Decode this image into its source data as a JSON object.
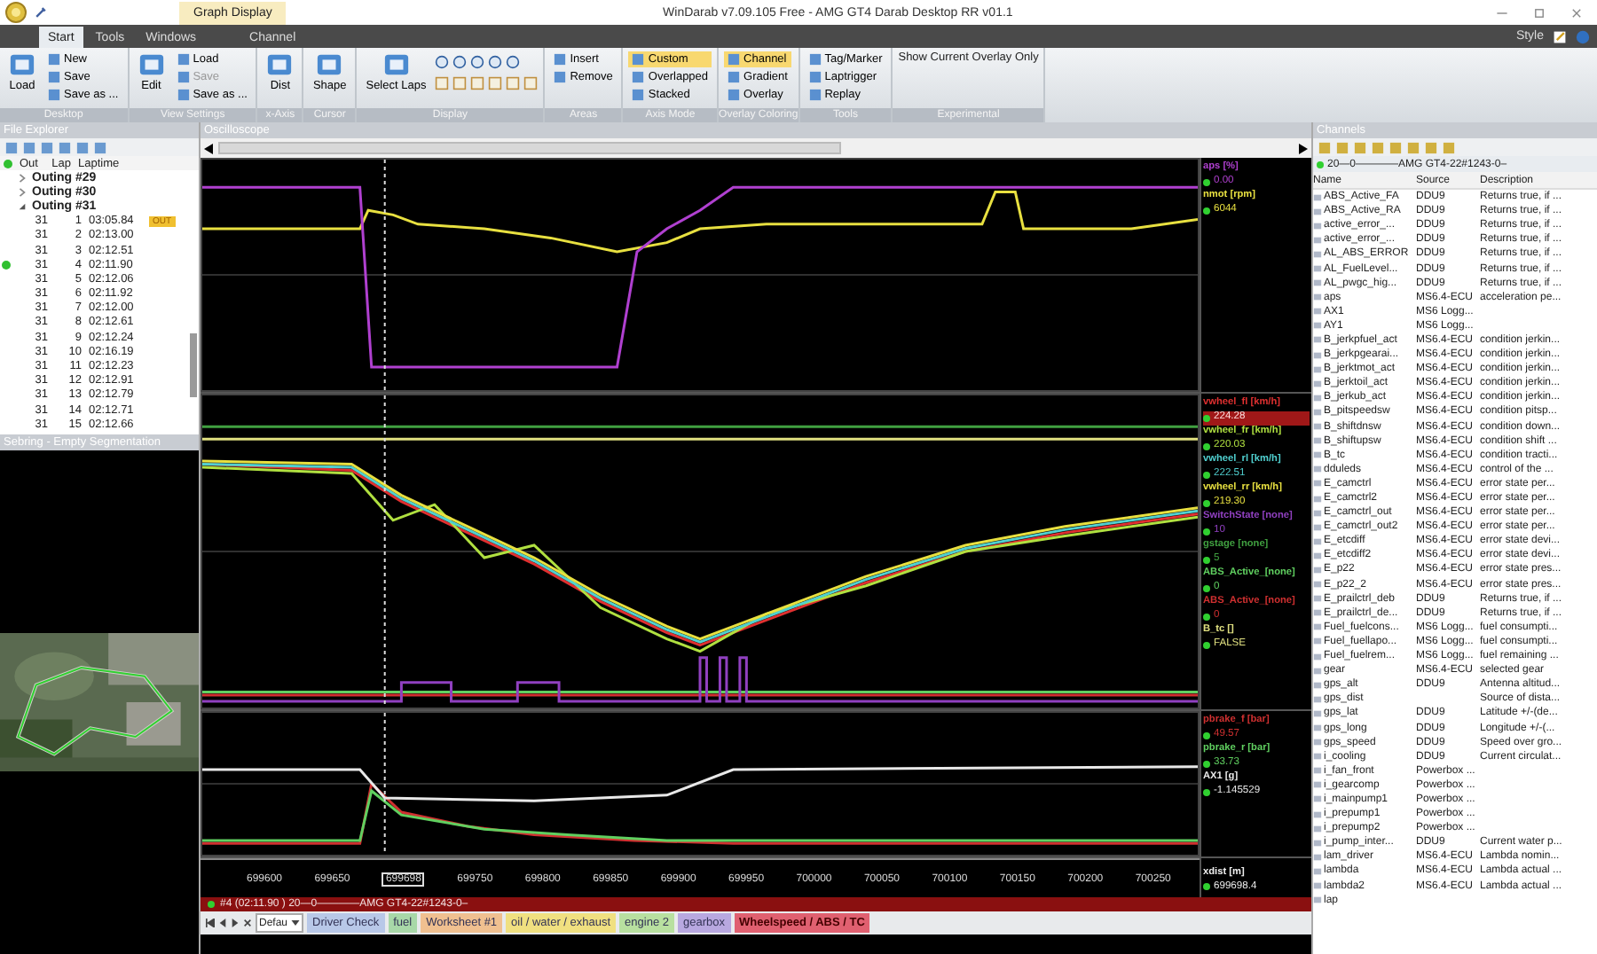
{
  "window": {
    "quick_tab": "Graph Display",
    "title": "WinDarab v7.09.105 Free - AMG GT4 Darab Desktop RR v01.1"
  },
  "menu_tabs": [
    {
      "label": "Start",
      "selected": true
    },
    {
      "label": "Tools",
      "selected": false
    },
    {
      "label": "Windows",
      "selected": false
    },
    {
      "label": "Channel",
      "selected": false
    }
  ],
  "style_label": "Style",
  "ribbon": [
    {
      "label": "Desktop",
      "kind": "standard",
      "items": [
        {
          "label": "Load",
          "kind": "large"
        },
        {
          "label": "New",
          "kind": "small"
        },
        {
          "label": "Save",
          "kind": "small"
        },
        {
          "label": "Save as ...",
          "kind": "small"
        }
      ]
    },
    {
      "label": "View Settings",
      "kind": "standard",
      "items": [
        {
          "label": "Edit",
          "kind": "large",
          "disabled": false
        },
        {
          "label": "Load",
          "kind": "small",
          "disabled": false
        },
        {
          "label": "Save",
          "kind": "small",
          "disabled": true
        },
        {
          "label": "Save as ...",
          "kind": "small",
          "disabled": false
        }
      ]
    },
    {
      "label": "x-Axis",
      "kind": "standard",
      "items": [
        {
          "label": "Dist",
          "kind": "large"
        }
      ]
    },
    {
      "label": "Cursor",
      "kind": "standard",
      "items": [
        {
          "label": "Shape",
          "kind": "large"
        }
      ]
    },
    {
      "label": "Display",
      "kind": "icons",
      "items": [
        {
          "label": "Select Laps",
          "kind": "large"
        }
      ]
    },
    {
      "label": "Areas",
      "kind": "standard",
      "items": [
        {
          "label": "Insert",
          "kind": "small"
        },
        {
          "label": "Remove",
          "kind": "small"
        }
      ]
    },
    {
      "label": "Axis Mode",
      "kind": "standard",
      "items": [
        {
          "label": "Custom",
          "kind": "small",
          "selected": true
        },
        {
          "label": "Overlapped",
          "kind": "small",
          "selected": false
        },
        {
          "label": "Stacked",
          "kind": "small",
          "selected": false
        }
      ]
    },
    {
      "label": "Overlay Coloring",
      "kind": "standard",
      "items": [
        {
          "label": "Channel",
          "kind": "small",
          "selected": true
        },
        {
          "label": "Gradient",
          "kind": "small",
          "selected": false
        },
        {
          "label": "Overlay",
          "kind": "small",
          "selected": false
        }
      ]
    },
    {
      "label": "Tools",
      "kind": "standard",
      "items": [
        {
          "label": "Tag/Marker",
          "kind": "small"
        },
        {
          "label": "Laptrigger",
          "kind": "small"
        },
        {
          "label": "Replay",
          "kind": "small"
        }
      ]
    },
    {
      "label": "Experimental",
      "kind": "standard",
      "items": [
        {
          "label": "Show Current Overlay Only",
          "kind": "text"
        }
      ]
    }
  ],
  "file_explorer": {
    "title": "File Explorer",
    "columns": [
      "Out",
      "Lap",
      "Laptime"
    ],
    "outings": [
      {
        "label": "Outing #29",
        "expanded": false
      },
      {
        "label": "Outing #30",
        "expanded": false
      },
      {
        "label": "Outing #31",
        "expanded": true,
        "laps": [
          {
            "out": "31",
            "lap": "1",
            "time": "03:05.84",
            "badge": "OUT",
            "loaded": false
          },
          {
            "out": "31",
            "lap": "2",
            "time": "02:13.00",
            "loaded": false
          },
          {
            "out": "31",
            "lap": "3",
            "time": "02:12.51",
            "loaded": false
          },
          {
            "out": "31",
            "lap": "4",
            "time": "02:11.90",
            "loaded": true
          },
          {
            "out": "31",
            "lap": "5",
            "time": "02:12.06",
            "loaded": false
          },
          {
            "out": "31",
            "lap": "6",
            "time": "02:11.92",
            "loaded": false
          },
          {
            "out": "31",
            "lap": "7",
            "time": "02:12.00",
            "loaded": false
          },
          {
            "out": "31",
            "lap": "8",
            "time": "02:12.61",
            "loaded": false
          },
          {
            "out": "31",
            "lap": "9",
            "time": "02:12.24",
            "loaded": false
          },
          {
            "out": "31",
            "lap": "10",
            "time": "02:16.19",
            "loaded": false
          },
          {
            "out": "31",
            "lap": "11",
            "time": "02:12.23",
            "loaded": false
          },
          {
            "out": "31",
            "lap": "12",
            "time": "02:12.91",
            "loaded": false
          },
          {
            "out": "31",
            "lap": "13",
            "time": "02:12.79",
            "loaded": false
          },
          {
            "out": "31",
            "lap": "14",
            "time": "02:12.71",
            "loaded": false
          },
          {
            "out": "31",
            "lap": "15",
            "time": "02:12.66",
            "loaded": false
          }
        ]
      }
    ]
  },
  "track_panel": {
    "title": "Sebring - Empty Segmentation"
  },
  "oscilloscope": {
    "title": "Oscilloscope",
    "panes": [
      {
        "legend": [
          {
            "label": "aps [%]",
            "value": "0.00",
            "color": "#b040d0",
            "selected": false
          },
          {
            "label": "nmot [rpm]",
            "value": "6044",
            "color": "#e8e040",
            "selected": false
          }
        ]
      },
      {
        "legend": [
          {
            "label": "vwheel_fl [km/h]",
            "value": "224.28",
            "color": "#e03030",
            "selected": true
          },
          {
            "label": "vwheel_fr [km/h]",
            "value": "220.03",
            "color": "#b0e040",
            "selected": false
          },
          {
            "label": "vwheel_rl [km/h]",
            "value": "222.51",
            "color": "#50d0d0",
            "selected": false
          },
          {
            "label": "vwheel_rr [km/h]",
            "value": "219.30",
            "color": "#e8e040",
            "selected": false
          },
          {
            "label": "SwitchState [none]",
            "value": "10",
            "color": "#9040c0",
            "selected": false
          },
          {
            "label": "gstage [none]",
            "value": "5",
            "color": "#40a040",
            "selected": false
          },
          {
            "label": "ABS_Active_[none]",
            "value": "0",
            "color": "#60d060",
            "selected": false
          },
          {
            "label": "ABS_Active_[none]",
            "value": "0",
            "color": "#d03030",
            "selected": false
          },
          {
            "label": "B_tc []",
            "value": "FALSE",
            "color": "#e0e080",
            "selected": false
          }
        ]
      },
      {
        "legend": [
          {
            "label": "pbrake_f [bar]",
            "value": "49.57",
            "color": "#d03030",
            "selected": false
          },
          {
            "label": "pbrake_r [bar]",
            "value": "33.73",
            "color": "#60d060",
            "selected": false
          },
          {
            "label": "AX1 [g]",
            "value": "-1.145529",
            "color": "#e8e8e8",
            "selected": false
          }
        ]
      }
    ],
    "x_ticks": [
      {
        "label": "699600",
        "cursor": false
      },
      {
        "label": "699650",
        "cursor": false
      },
      {
        "label": "699698",
        "cursor": true
      },
      {
        "label": "699750",
        "cursor": false
      },
      {
        "label": "699800",
        "cursor": false
      },
      {
        "label": "699850",
        "cursor": false
      },
      {
        "label": "699900",
        "cursor": false
      },
      {
        "label": "699950",
        "cursor": false
      },
      {
        "label": "700000",
        "cursor": false
      },
      {
        "label": "700050",
        "cursor": false
      },
      {
        "label": "700100",
        "cursor": false
      },
      {
        "label": "700150",
        "cursor": false
      },
      {
        "label": "700200",
        "cursor": false
      },
      {
        "label": "700250",
        "cursor": false
      }
    ],
    "x_legend": {
      "label": "xdist [m]",
      "value": "699698.4"
    },
    "status": "#4 (02:11.90 ) 20—0————AMG GT4-22#1243-0–"
  },
  "worksheet_tabs": {
    "layout": "Defau",
    "tabs": [
      {
        "label": "Driver Check",
        "color": "#b8c8e8",
        "selected": false
      },
      {
        "label": "fuel",
        "color": "#a8d8a8",
        "selected": false
      },
      {
        "label": "Worksheet #1",
        "color": "#f0c090",
        "selected": false
      },
      {
        "label": "oil / water / exhaust",
        "color": "#f0e080",
        "selected": false
      },
      {
        "label": "engine 2",
        "color": "#b8e0a0",
        "selected": false
      },
      {
        "label": "gearbox",
        "color": "#b8a8e0",
        "selected": false
      },
      {
        "label": "Wheelspeed / ABS / TC",
        "color": "#e06070",
        "selected": true
      }
    ]
  },
  "channels": {
    "title": "Channels",
    "dataset": "20—0————AMG GT4-22#1243-0–",
    "columns": [
      "Name",
      "Source",
      "Description"
    ],
    "rows": [
      {
        "name": "ABS_Active_FA",
        "source": "DDU9",
        "description": "Returns true, if ..."
      },
      {
        "name": "ABS_Active_RA",
        "source": "DDU9",
        "description": "Returns true, if ..."
      },
      {
        "name": "active_error_...",
        "source": "DDU9",
        "description": "Returns true, if ..."
      },
      {
        "name": "active_error_...",
        "source": "DDU9",
        "description": "Returns true, if ..."
      },
      {
        "name": "AL_ABS_ERROR",
        "source": "DDU9",
        "description": "Returns true, if ..."
      },
      {
        "name": "AL_FuelLevel...",
        "source": "DDU9",
        "description": "Returns true, if ..."
      },
      {
        "name": "AL_pwgc_hig...",
        "source": "DDU9",
        "description": "Returns true, if ..."
      },
      {
        "name": "aps",
        "source": "MS6.4-ECU",
        "description": "acceleration pe..."
      },
      {
        "name": "AX1",
        "source": "MS6 Logg..."
      },
      {
        "name": "AY1",
        "source": "MS6 Logg..."
      },
      {
        "name": "B_jerkpfuel_act",
        "source": "MS6.4-ECU",
        "description": "condition jerkin..."
      },
      {
        "name": "B_jerkpgearai...",
        "source": "MS6.4-ECU",
        "description": "condition jerkin..."
      },
      {
        "name": "B_jerktmot_act",
        "source": "MS6.4-ECU",
        "description": "condition jerkin..."
      },
      {
        "name": "B_jerktoil_act",
        "source": "MS6.4-ECU",
        "description": "condition jerkin..."
      },
      {
        "name": "B_jerkub_act",
        "source": "MS6.4-ECU",
        "description": "condition jerkin..."
      },
      {
        "name": "B_pitspeedsw",
        "source": "MS6.4-ECU",
        "description": "condition pitsp..."
      },
      {
        "name": "B_shiftdnsw",
        "source": "MS6.4-ECU",
        "description": "condition down..."
      },
      {
        "name": "B_shiftupsw",
        "source": "MS6.4-ECU",
        "description": "condition shift ..."
      },
      {
        "name": "B_tc",
        "source": "MS6.4-ECU",
        "description": "condition tracti..."
      },
      {
        "name": "dduleds",
        "source": "MS6.4-ECU",
        "description": "control of the ..."
      },
      {
        "name": "E_camctrl",
        "source": "MS6.4-ECU",
        "description": "error state per..."
      },
      {
        "name": "E_camctrl2",
        "source": "MS6.4-ECU",
        "description": "error state per..."
      },
      {
        "name": "E_camctrl_out",
        "source": "MS6.4-ECU",
        "description": "error state per..."
      },
      {
        "name": "E_camctrl_out2",
        "source": "MS6.4-ECU",
        "description": "error state per..."
      },
      {
        "name": "E_etcdiff",
        "source": "MS6.4-ECU",
        "description": "error state devi..."
      },
      {
        "name": "E_etcdiff2",
        "source": "MS6.4-ECU",
        "description": "error state devi..."
      },
      {
        "name": "E_p22",
        "source": "MS6.4-ECU",
        "description": "error state pres..."
      },
      {
        "name": "E_p22_2",
        "source": "MS6.4-ECU",
        "description": "error state pres..."
      },
      {
        "name": "E_prailctrl_deb",
        "source": "DDU9",
        "description": "Returns true, if ..."
      },
      {
        "name": "E_prailctrl_de...",
        "source": "DDU9",
        "description": "Returns true, if ..."
      },
      {
        "name": "Fuel_fuelcons...",
        "source": "MS6 Logg...",
        "description": "fuel consumpti..."
      },
      {
        "name": "Fuel_fuellapo...",
        "source": "MS6 Logg...",
        "description": "fuel consumpti..."
      },
      {
        "name": "Fuel_fuelrem...",
        "source": "MS6 Logg...",
        "description": "fuel remaining ..."
      },
      {
        "name": "gear",
        "source": "MS6.4-ECU",
        "description": "selected gear"
      },
      {
        "name": "gps_alt",
        "source": "DDU9",
        "description": "Antenna altitud..."
      },
      {
        "name": "gps_dist",
        "description": "Source of dista..."
      },
      {
        "name": "gps_lat",
        "source": "DDU9",
        "description": "Latitude +/-(de..."
      },
      {
        "name": "gps_long",
        "source": "DDU9",
        "description": "Longitude +/-(..."
      },
      {
        "name": "gps_speed",
        "source": "DDU9",
        "description": "Speed over gro..."
      },
      {
        "name": "i_cooling",
        "source": "DDU9",
        "description": "Current circulat..."
      },
      {
        "name": "i_fan_front",
        "source": "Powerbox ..."
      },
      {
        "name": "i_gearcomp",
        "source": "Powerbox ..."
      },
      {
        "name": "i_mainpump1",
        "source": "Powerbox ..."
      },
      {
        "name": "i_prepump1",
        "source": "Powerbox ..."
      },
      {
        "name": "i_prepump2",
        "source": "Powerbox ..."
      },
      {
        "name": "i_pump_inter...",
        "source": "DDU9",
        "description": "Current water p..."
      },
      {
        "name": "lam_driver",
        "source": "MS6.4-ECU",
        "description": "Lambda nomin..."
      },
      {
        "name": "lambda",
        "source": "MS6.4-ECU",
        "description": "Lambda actual ..."
      },
      {
        "name": "lambda2",
        "source": "MS6.4-ECU",
        "description": "Lambda actual ..."
      },
      {
        "name": "lap"
      }
    ]
  }
}
